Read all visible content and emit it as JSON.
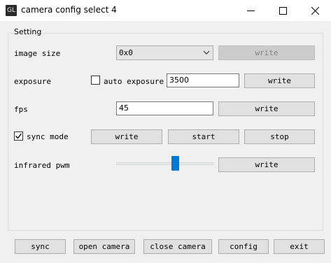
{
  "window": {
    "title": "camera config select 4",
    "icon_text": "GL"
  },
  "setting_group": {
    "title": "Setting"
  },
  "image_size": {
    "label": "image size",
    "value": "0x0",
    "write_label": "write"
  },
  "exposure": {
    "label": "exposure",
    "auto_label": "auto exposure",
    "auto_checked": false,
    "value": "3500",
    "write_label": "write"
  },
  "fps": {
    "label": "fps",
    "value": "45",
    "write_label": "write"
  },
  "sync_mode": {
    "label": "sync mode",
    "checked": true,
    "write_label": "write",
    "start_label": "start",
    "stop_label": "stop"
  },
  "infrared_pwm": {
    "label": "infrared pwm",
    "level": 0.62,
    "write_label": "write"
  },
  "bottom_buttons": {
    "sync": "sync",
    "open_camera": "open camera",
    "close_camera": "close camera",
    "config": "config",
    "exit": "exit"
  },
  "colors": {
    "accent": "#0078d7"
  }
}
